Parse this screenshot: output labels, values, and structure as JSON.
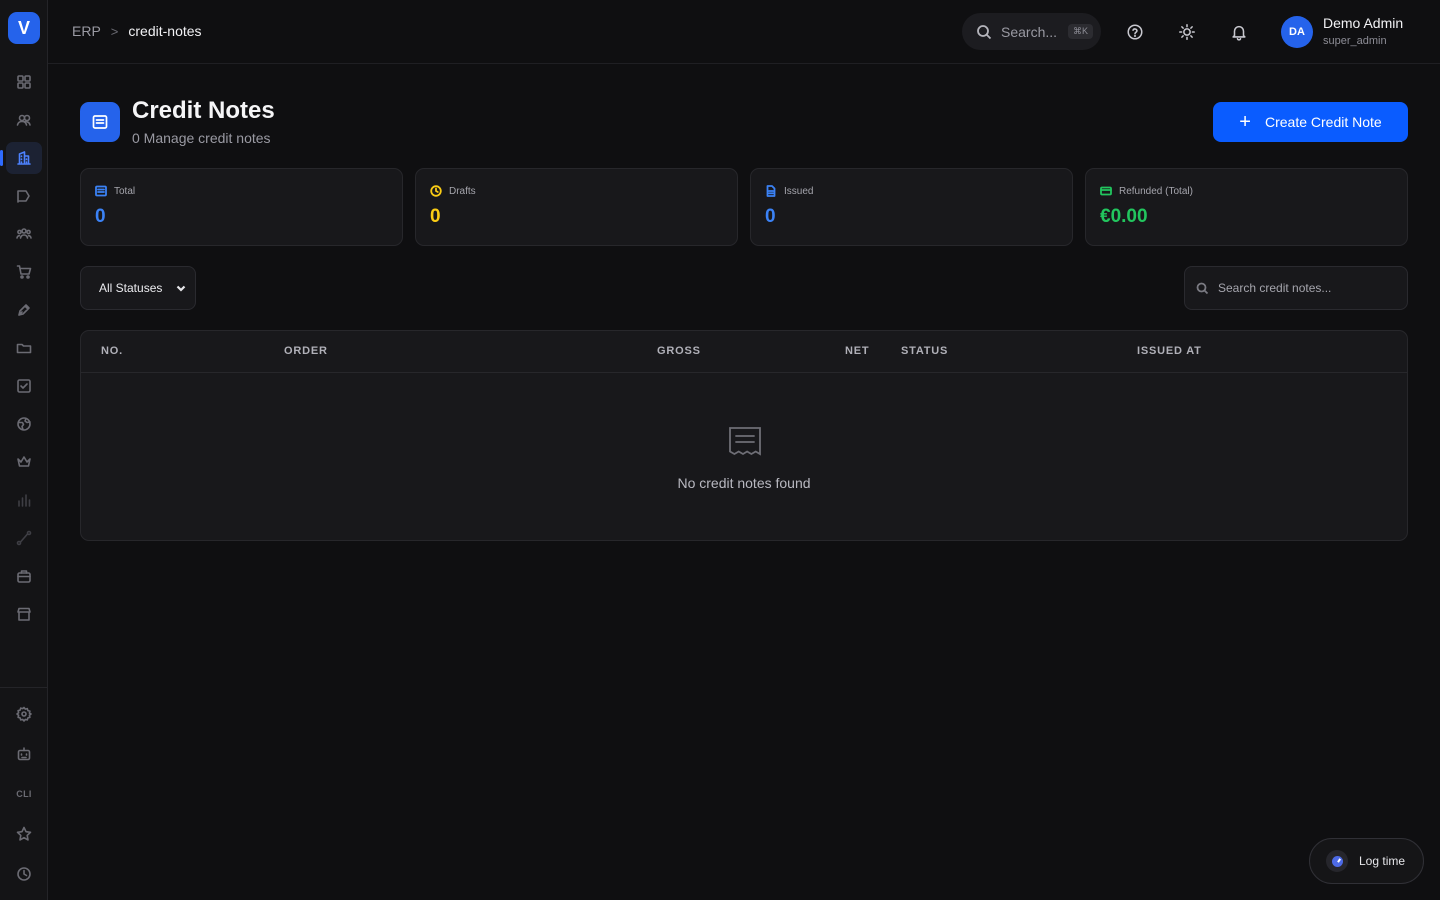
{
  "app": {
    "logo_letter": "V"
  },
  "breadcrumb": {
    "root": "ERP",
    "separator": ">",
    "current": "credit-notes"
  },
  "topbar": {
    "search_placeholder": "Search...",
    "search_shortcut": "⌘K"
  },
  "user": {
    "initials": "DA",
    "name": "Demo Admin",
    "role": "super_admin"
  },
  "sidebar": {
    "items": [
      {
        "name": "dashboard-icon"
      },
      {
        "name": "users-icon"
      },
      {
        "name": "building-icon",
        "active": true
      },
      {
        "name": "megaphone-icon"
      },
      {
        "name": "team-icon"
      },
      {
        "name": "cart-icon"
      },
      {
        "name": "pen-icon"
      },
      {
        "name": "folder-icon"
      },
      {
        "name": "checkbox-icon"
      },
      {
        "name": "globe-icon"
      },
      {
        "name": "crown-icon"
      },
      {
        "name": "bar-chart-icon"
      },
      {
        "name": "route-icon"
      },
      {
        "name": "briefcase-icon"
      },
      {
        "name": "store-icon"
      }
    ],
    "bottom": {
      "cli_label": "CLI"
    }
  },
  "page": {
    "title": "Credit Notes",
    "subtitle": "0 Manage credit notes",
    "create_label": "Create Credit Note"
  },
  "stats": [
    {
      "label": "Total",
      "value": "0",
      "color": "#3b82f6"
    },
    {
      "label": "Drafts",
      "value": "0",
      "color": "#facc15"
    },
    {
      "label": "Issued",
      "value": "0",
      "color": "#3b82f6"
    },
    {
      "label": "Refunded (Total)",
      "value": "€0.00",
      "color": "#22c55e"
    }
  ],
  "filters": {
    "status_selected": "All Statuses",
    "search_placeholder": "Search credit notes..."
  },
  "table": {
    "columns": [
      "NO.",
      "ORDER",
      "GROSS",
      "NET",
      "STATUS",
      "ISSUED AT"
    ],
    "empty_message": "No credit notes found"
  },
  "log_time": {
    "label": "Log time"
  },
  "colors": {
    "accent": "#2563eb",
    "button": "#0a5cff",
    "background": "#0f0f11",
    "card": "#18181b"
  }
}
